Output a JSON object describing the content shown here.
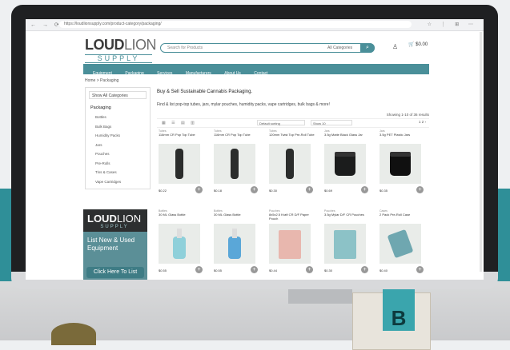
{
  "browser": {
    "nav_glyphs": "← → ⟳",
    "url": "https://loudlionsupply.com/product-category/packaging/",
    "tool_glyphs": "☆ ⋮ ⊞ ⋯"
  },
  "header": {
    "logo_main": "LOUD",
    "logo_light": "LION",
    "logo_sub": "SUPPLY",
    "search_placeholder": "Search for Products",
    "search_category": "All Categories",
    "search_button": "⌕",
    "user_icon": "♙",
    "cart_text": "🛒 $0.00"
  },
  "nav": [
    "Equipment",
    "Packaging",
    "Services",
    "Manufacturers",
    "About Us",
    "Contact"
  ],
  "breadcrumb": "Home  >  Packaging",
  "sidebar": {
    "all_categories": "Show All Categories",
    "section": "Packaging",
    "items": [
      "Bottles",
      "Bulk Bags",
      "Humidity Packs",
      "Jars",
      "Pouches",
      "Pre-Rolls",
      "Tins & Cases",
      "Vape Cartridges"
    ]
  },
  "promo": {
    "logo_main": "LOUD",
    "logo_light": "LION",
    "logo_sub": "SUPPLY",
    "text": "List New & Used Equipment",
    "button": "Click Here To List"
  },
  "content": {
    "title": "Buy & Sell Sustainable Cannabis Packaging.",
    "subtitle": "Find & list pop-top tubes, jars, mylar pouches, humidity packs, vape cartridges, bulk bags & more!",
    "showing": "Showing 1-10 of 36 results",
    "view_glyphs": "▦ ☰ ▤ ▥",
    "sort": "Default sorting",
    "show": "Show 10",
    "pagination": "1  2  ›"
  },
  "products": [
    {
      "category": "Tubes",
      "name": "116mm CR Pop Top Tube",
      "color": "#2b2d2c",
      "shape": "tube",
      "price": "$0.22"
    },
    {
      "category": "Tubes",
      "name": "116mm CR Pop Top Tube",
      "color": "#2b2d2c",
      "shape": "tube",
      "price": "$0.18"
    },
    {
      "category": "Tubes",
      "name": "120mm Twist Top Pre-Roll Tube",
      "color": "#2b2d2c",
      "shape": "tube",
      "price": "$0.30"
    },
    {
      "category": "Jars",
      "name": "3.5g Matte Black Glass Jar",
      "color": "#1b1c1c",
      "shape": "jar",
      "price": "$0.69"
    },
    {
      "category": "Jars",
      "name": "3.5g PET Plastic Jars",
      "color": "#101010",
      "shape": "jar",
      "price": "$0.35"
    },
    {
      "category": "Bottles",
      "name": "30 ML Glass Bottle",
      "color": "#8fd0da",
      "shape": "bottle",
      "price": "$0.55"
    },
    {
      "category": "Bottles",
      "name": "30 ML Glass Bottle",
      "color": "#5aa7d8",
      "shape": "bottle",
      "price": "$0.55"
    },
    {
      "category": "Pouches",
      "name": "8x5x2.5 Kraft CR D/F Paper Pouch",
      "color": "#e8b7ae",
      "shape": "pouch",
      "price": "$0.44"
    },
    {
      "category": "Pouches",
      "name": "3.5g Mylar D/F CR Pouches",
      "color": "#8cc2c7",
      "shape": "pouch",
      "price": "$0.30"
    },
    {
      "category": "Cases",
      "name": "2 Pack Pre-Roll Case",
      "color": "#6fa7b0",
      "shape": "case",
      "price": "$0.40"
    }
  ]
}
